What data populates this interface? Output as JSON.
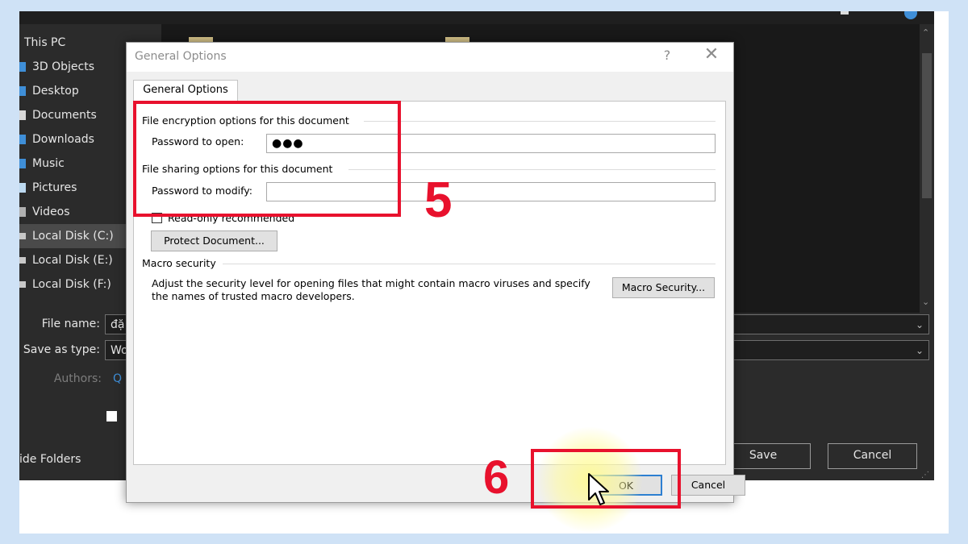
{
  "explorer": {
    "nav_items": [
      {
        "label": "This PC",
        "icon": "pc-icon"
      },
      {
        "label": "3D Objects",
        "icon": "cube-icon"
      },
      {
        "label": "Desktop",
        "icon": "desktop-icon"
      },
      {
        "label": "Documents",
        "icon": "document-icon"
      },
      {
        "label": "Downloads",
        "icon": "download-icon"
      },
      {
        "label": "Music",
        "icon": "music-icon"
      },
      {
        "label": "Pictures",
        "icon": "picture-icon"
      },
      {
        "label": "Videos",
        "icon": "video-icon"
      },
      {
        "label": "Local Disk (C:)",
        "icon": "disk-icon"
      },
      {
        "label": "Local Disk (E:)",
        "icon": "disk-icon"
      },
      {
        "label": "Local Disk (F:)",
        "icon": "disk-icon"
      }
    ],
    "selected_nav": "Local Disk (C:)",
    "file_name_label": "File name:",
    "file_name_value": "đặ",
    "save_type_label": "Save as type:",
    "save_type_value": "Wo",
    "authors_label": "Authors:",
    "authors_value": "Q",
    "hide_folders_label": "ide Folders",
    "save_button": "Save",
    "cancel_button": "Cancel"
  },
  "dialog": {
    "title": "General Options",
    "help": "?",
    "close": "✕",
    "tab_label": "General Options",
    "encryption_header": "File encryption options for this document",
    "password_open_label": "Password to open:",
    "password_open_value": "●●●",
    "sharing_header": "File sharing options for this document",
    "password_modify_label": "Password to modify:",
    "password_modify_value": "",
    "readonly_label": "Read-only recommended",
    "readonly_checked": false,
    "protect_button": "Protect Document...",
    "macro_header": "Macro security",
    "macro_text_line1": "Adjust the security level for opening files that might contain macro viruses and specify",
    "macro_text_line2": "the names of trusted macro developers.",
    "macro_button": "Macro Security...",
    "ok_button": "OK",
    "cancel_button": "Cancel"
  },
  "annotations": {
    "step5": "5",
    "step6": "6",
    "highlight_color": "#e8112d"
  },
  "colors": {
    "dark_background": "#2b2b2b",
    "dialog_background": "#f0f0f0",
    "page_background": "#cfe2f6"
  }
}
